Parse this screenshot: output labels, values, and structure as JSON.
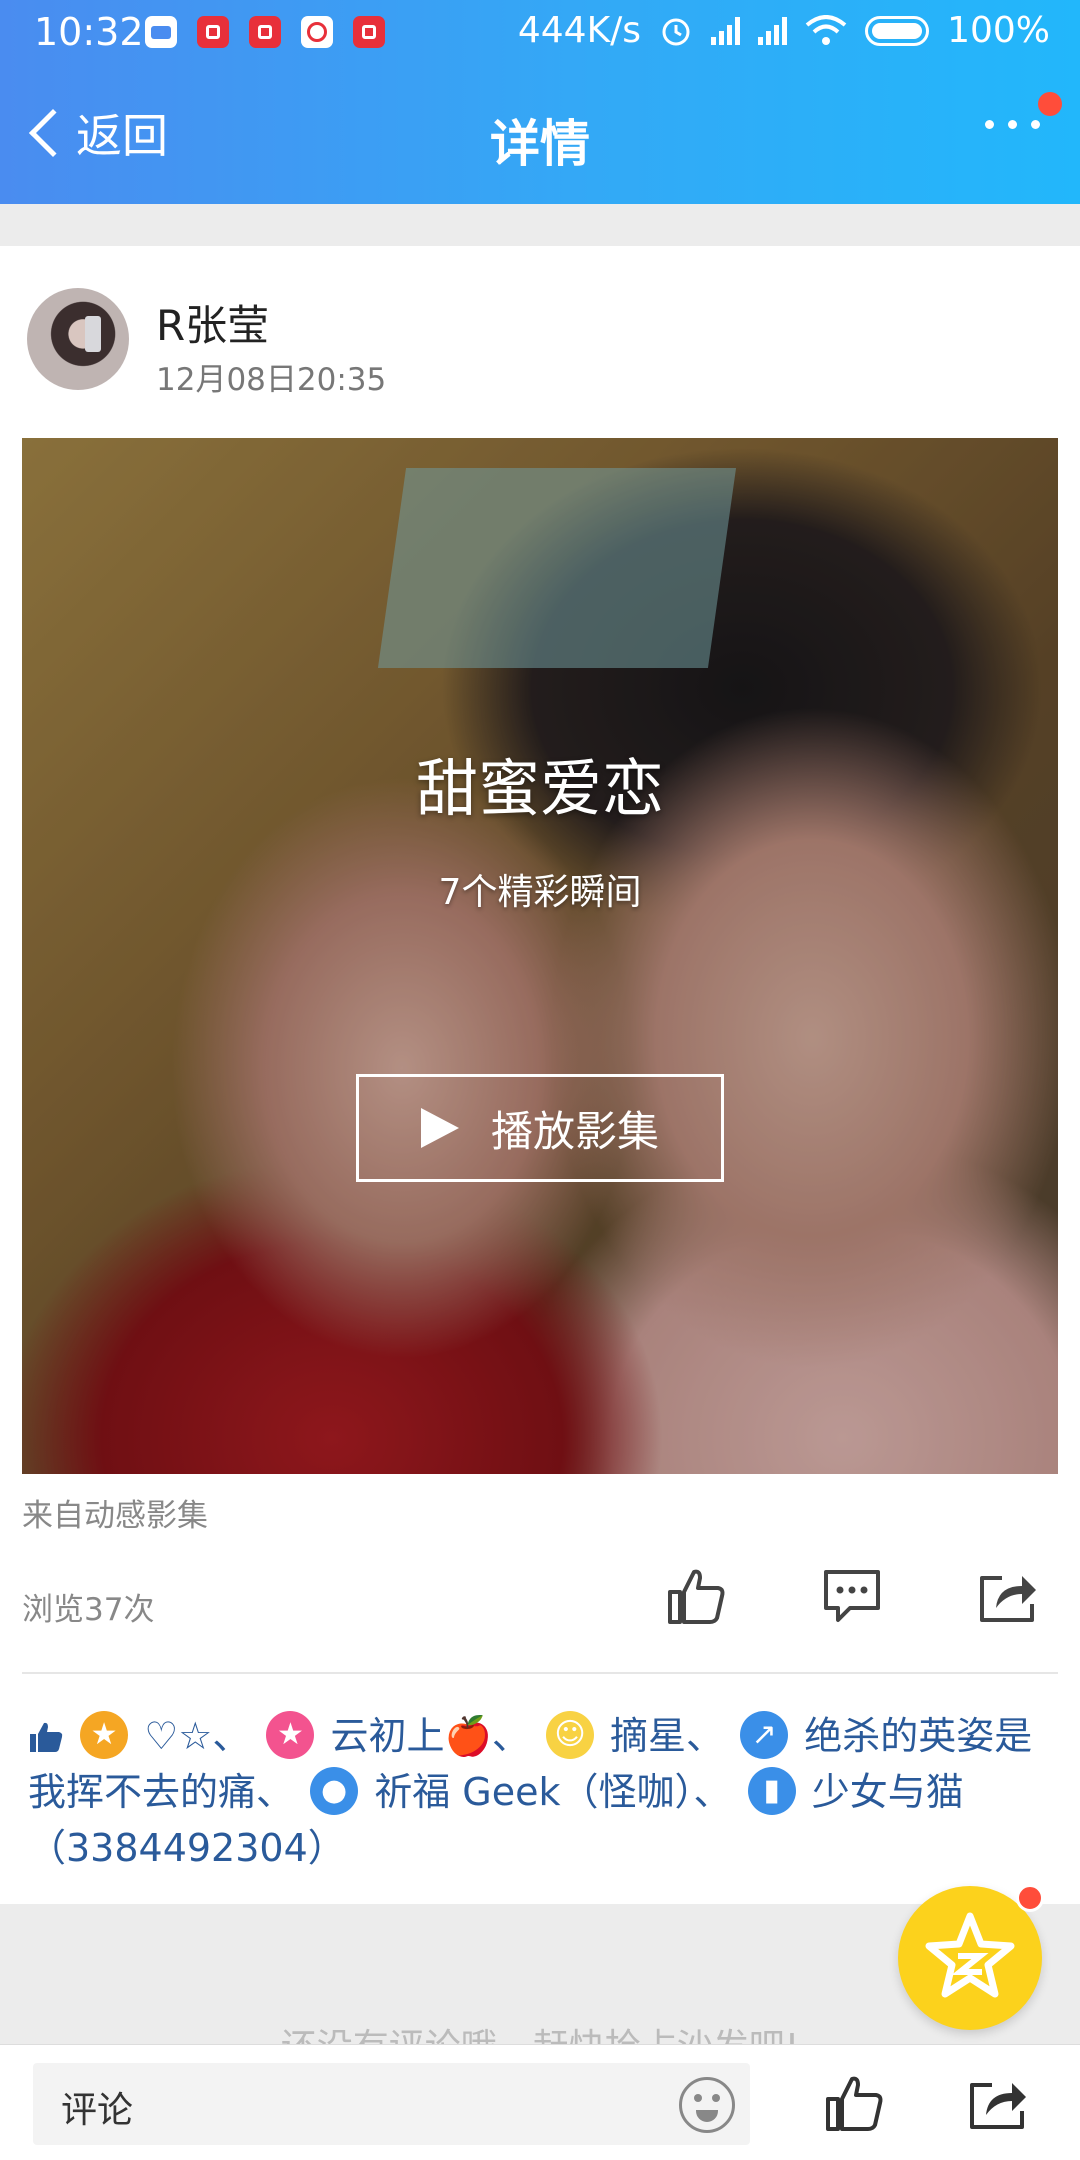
{
  "status_bar": {
    "time": "10:32",
    "net_speed": "444K/s",
    "battery": "100%"
  },
  "header": {
    "back_label": "返回",
    "title": "详情"
  },
  "post": {
    "username": "R张莹",
    "timestamp": "12月08日20:35",
    "album": {
      "title": "甜蜜爱恋",
      "subtitle": "7个精彩瞬间",
      "play_label": "播放影集"
    },
    "source": "来自动感影集",
    "views": "浏览37次"
  },
  "likes": {
    "parts": {
      "p1": "♡☆、",
      "p2": "云初上",
      "p3": "🍎、",
      "p4": "摘星、",
      "p5": "绝杀的英姿是我挥不去的痛、",
      "p6": "祈福   Geek（怪咖）、",
      "p7": "少女与猫（3384492304）"
    }
  },
  "comments": {
    "empty_hint": "还没有评论哦，赶快抢占沙发吧!"
  },
  "bottom_bar": {
    "comment_label": "评论"
  },
  "colors": {
    "header_gradient_start": "#4a8cf0",
    "header_gradient_end": "#22b7fb",
    "like_text": "#2a5a9a",
    "fab": "#fcd21c",
    "badge": "#ff4d3a"
  }
}
